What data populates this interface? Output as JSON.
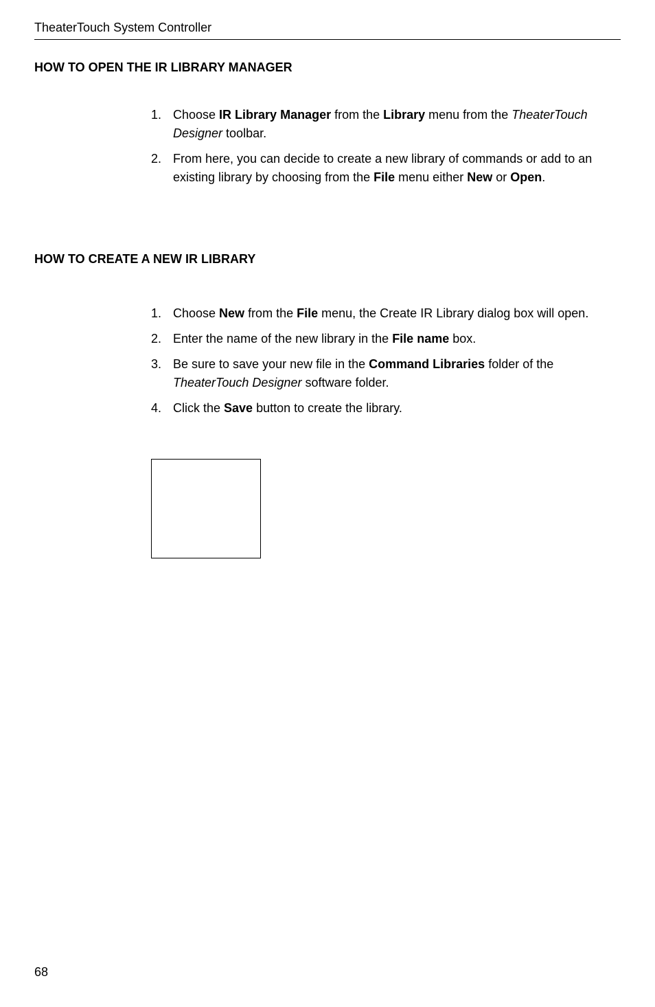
{
  "header": {
    "title": "TheaterTouch System Controller"
  },
  "section1": {
    "heading": "HOW TO OPEN THE IR LIBRARY MANAGER",
    "items": [
      {
        "number": "1.",
        "prefix": "Choose ",
        "bold1": "IR Library Manager",
        "mid1": " from the ",
        "bold2": "Library",
        "mid2": " menu from the ",
        "italic1": "TheaterTouch Designer",
        "suffix": " toolbar."
      },
      {
        "number": "2.",
        "prefix": "From here, you can decide to create a new library of commands or add to an existing library by choosing from the ",
        "bold1": "File",
        "mid1": " menu either ",
        "bold2": "New",
        "mid2": " or ",
        "bold3": "Open",
        "suffix": "."
      }
    ]
  },
  "section2": {
    "heading": "HOW TO CREATE A NEW IR LIBRARY",
    "items": [
      {
        "number": "1.",
        "prefix": "Choose ",
        "bold1": "New",
        "mid1": " from the ",
        "bold2": "File",
        "suffix": " menu, the Create IR Library dialog box will open."
      },
      {
        "number": "2.",
        "prefix": "Enter the name of the new library in the ",
        "bold1": "File name",
        "suffix": " box."
      },
      {
        "number": "3.",
        "prefix": "Be sure to save your new file in the ",
        "bold1": "Command Libraries",
        "mid1": " folder of the ",
        "italic1": "TheaterTouch Designer",
        "suffix": " software folder."
      },
      {
        "number": "4.",
        "prefix": "Click the ",
        "bold1": "Save",
        "suffix": " button to create the library."
      }
    ]
  },
  "footer": {
    "pageNumber": "68"
  }
}
